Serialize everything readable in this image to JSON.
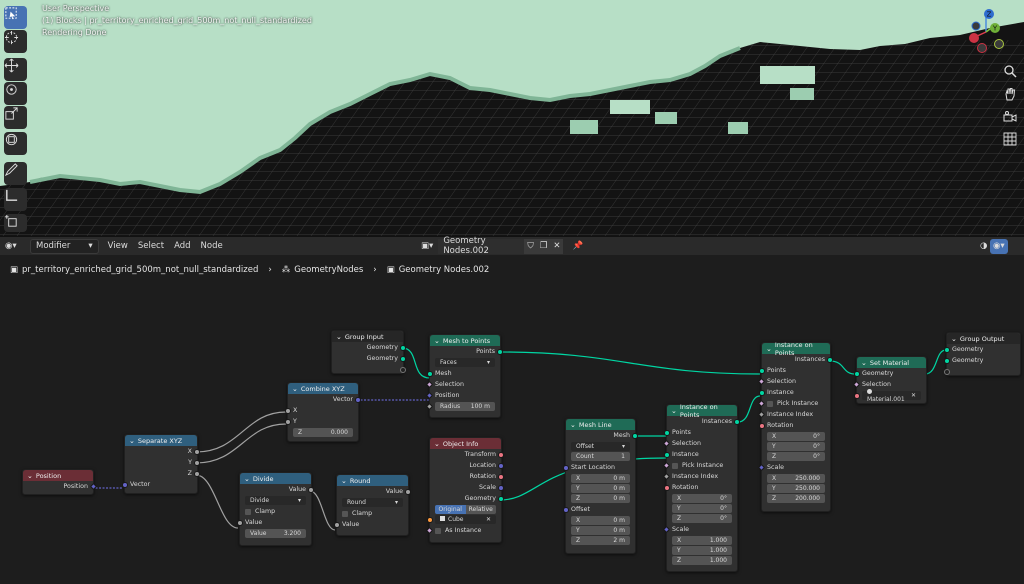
{
  "viewport": {
    "mode": "User Perspective",
    "collection": "(1) Blocks | pr_territory_enriched_grid_500m_not_null_standardized",
    "status": "Rendering Done"
  },
  "header": {
    "editor": "Modifier",
    "menus": [
      "View",
      "Select",
      "Add",
      "Node"
    ],
    "tree_name": "Geometry Nodes.002"
  },
  "breadcrumb": {
    "object": "pr_territory_enriched_grid_500m_not_null_standardized",
    "modifier": "GeometryNodes",
    "tree": "Geometry Nodes.002"
  },
  "gizmo": {
    "z": "Z",
    "y": "Y",
    "x": "X"
  },
  "nodes": {
    "position": {
      "title": "Position",
      "out": "Position"
    },
    "separate": {
      "title": "Separate XYZ",
      "x": "X",
      "y": "Y",
      "z": "Z",
      "in": "Vector"
    },
    "combine": {
      "title": "Combine XYZ",
      "out": "Vector",
      "x": "X",
      "y": "Y",
      "z_label": "Z",
      "z_val": "0.000"
    },
    "group_input": {
      "title": "Group Input",
      "g1": "Geometry",
      "g2": "Geometry"
    },
    "m2p": {
      "title": "Mesh to Points",
      "out": "Points",
      "mode": "Faces",
      "mesh": "Mesh",
      "sel": "Selection",
      "pos": "Position",
      "radius_label": "Radius",
      "radius_val": "100 m"
    },
    "divide": {
      "title": "Divide",
      "out": "Value",
      "op": "Divide",
      "clamp": "Clamp",
      "val": "Value",
      "val_label": "Value",
      "val_num": "3.200"
    },
    "round": {
      "title": "Round",
      "out": "Value",
      "op": "Round",
      "clamp": "Clamp",
      "val": "Value"
    },
    "objinfo": {
      "title": "Object Info",
      "transform": "Transform",
      "location": "Location",
      "rotation": "Rotation",
      "scale": "Scale",
      "geometry": "Geometry",
      "original": "Original",
      "relative": "Relative",
      "obj": "Cube",
      "as_instance": "As Instance"
    },
    "meshline": {
      "title": "Mesh Line",
      "out": "Mesh",
      "mode": "Offset",
      "count_label": "Count",
      "count_val": "1",
      "start": "Start Location",
      "sx": "X",
      "sxv": "0 m",
      "sy": "Y",
      "syv": "0 m",
      "sz": "Z",
      "szv": "0 m",
      "offset": "Offset",
      "ox": "X",
      "oxv": "0 m",
      "oy": "Y",
      "oyv": "0 m",
      "oz": "Z",
      "ozv": "2 m"
    },
    "iop1": {
      "title": "Instance on Points",
      "out": "Instances",
      "points": "Points",
      "sel": "Selection",
      "inst": "Instance",
      "pick": "Pick Instance",
      "index": "Instance Index",
      "rot": "Rotation",
      "rx": "X",
      "rxv": "0°",
      "ry": "Y",
      "ryv": "0°",
      "rz": "Z",
      "rzv": "0°",
      "scale": "Scale",
      "scx": "X",
      "scxv": "1.000",
      "scy": "Y",
      "scyv": "1.000",
      "scz": "Z",
      "sczv": "1.000"
    },
    "iop2": {
      "title": "Instance on Points",
      "out": "Instances",
      "points": "Points",
      "sel": "Selection",
      "inst": "Instance",
      "pick": "Pick Instance",
      "index": "Instance Index",
      "rot": "Rotation",
      "rx": "X",
      "rxv": "0°",
      "ry": "Y",
      "ryv": "0°",
      "rz": "Z",
      "rzv": "0°",
      "scale": "Scale",
      "scx": "X",
      "scxv": "250.000",
      "scy": "Y",
      "scyv": "250.000",
      "scz": "Z",
      "sczv": "200.000"
    },
    "setmat": {
      "title": "Set Material",
      "geometry": "Geometry",
      "sel": "Selection",
      "mat": "Material.001"
    },
    "group_output": {
      "title": "Group Output",
      "g1": "Geometry",
      "g2": "Geometry"
    }
  }
}
